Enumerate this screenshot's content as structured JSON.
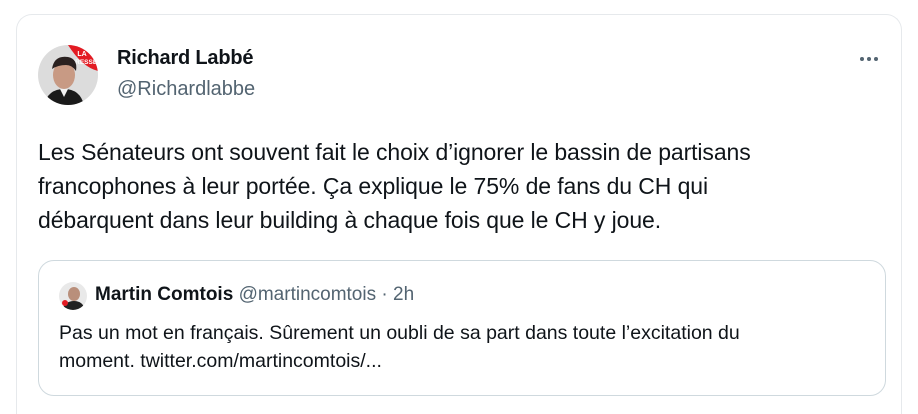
{
  "tweet": {
    "author_name": "Richard Labbé",
    "author_handle": "@Richardlabbe",
    "avatar_badge": "LA PRESSE",
    "more_icon": "more-horizontal-icon",
    "text_lines": [
      "Les Sénateurs ont souvent fait le choix d’ignorer le bassin de partisans",
      "francophones à leur portée. Ça explique le 75% de fans du CH qui",
      "débarquent dans leur building à chaque fois que le CH y joue."
    ]
  },
  "quoted": {
    "author_name": "Martin Comtois",
    "author_handle": "@martincomtois",
    "separator": "·",
    "time": "2h",
    "text_lines": [
      "Pas un mot en français. Sûrement un oubli de sa part dans toute l’excitation du",
      "moment. twitter.com/martincomtois/..."
    ]
  },
  "colors": {
    "text_primary": "#0f1419",
    "text_secondary": "#536471",
    "border": "#cfd9de",
    "badge_red": "#e31b23"
  }
}
